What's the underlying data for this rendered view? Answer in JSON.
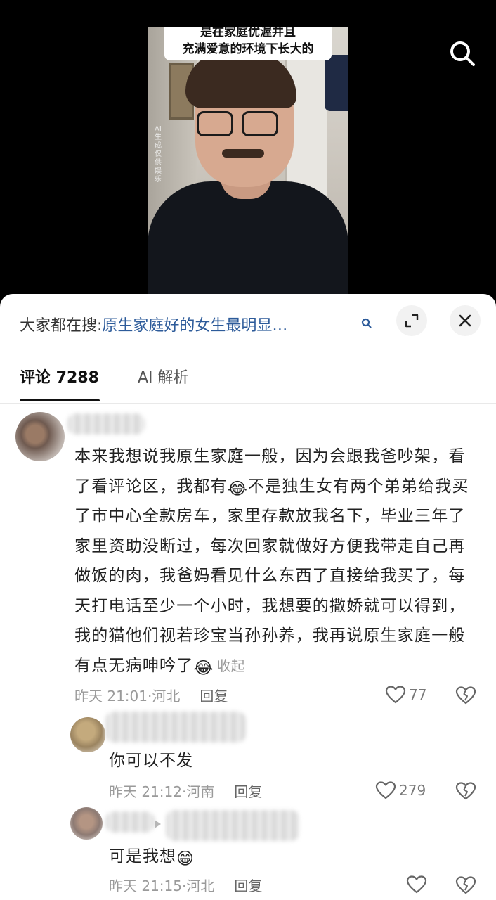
{
  "video": {
    "caption_line1": "是在家庭优渥并且",
    "caption_line2": "充满爱意的环境下长大的",
    "ai_label": "AI生成 仅供娱乐",
    "search_icon": "search-icon"
  },
  "sheet": {
    "search_prefix": "大家都在搜:",
    "search_query": "原生家庭好的女生最明显…",
    "tabs": [
      {
        "label": "评论 7288",
        "active": true
      },
      {
        "label": "AI 解析",
        "active": false
      }
    ]
  },
  "comments": [
    {
      "text_before_emoji1": "本来我想说我原生家庭一般，因为会跟我爸吵架，看了看评论区，我都有",
      "emoji1": "😂",
      "text_middle": "不是独生女有两个弟弟给我买了市中心全款房车，家里存款放我名下，毕业三年了家里资助没断过，每次回家就做好方便我带走自己再做饭的肉，我爸妈看见什么东西了直接给我买了，每天打电话至少一个小时，我想要的撒娇就可以得到，我的猫他们视若珍宝当孙孙养，我再说原生家庭一般有点无病呻吟了",
      "emoji2": "😂",
      "collapse": "收起",
      "time": "昨天 21:01·河北",
      "reply": "回复",
      "likes": "77"
    },
    {
      "text": "你可以不发",
      "time": "昨天 21:12·河南",
      "reply": "回复",
      "likes": "279"
    },
    {
      "text": "可是我想",
      "emoji": "😁",
      "time": "昨天 21:15·河北",
      "reply": "回复",
      "likes": ""
    }
  ]
}
